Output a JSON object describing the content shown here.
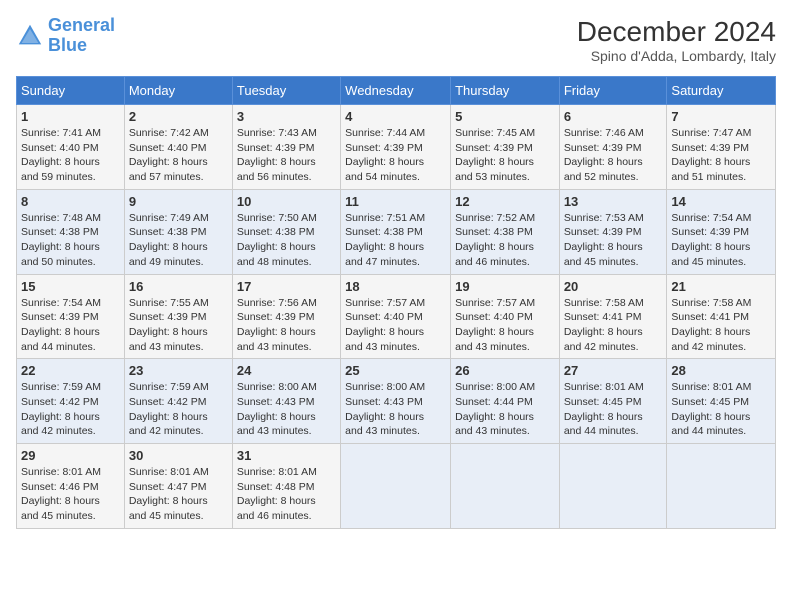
{
  "header": {
    "logo_line1": "General",
    "logo_line2": "Blue",
    "month_year": "December 2024",
    "location": "Spino d'Adda, Lombardy, Italy"
  },
  "weekdays": [
    "Sunday",
    "Monday",
    "Tuesday",
    "Wednesday",
    "Thursday",
    "Friday",
    "Saturday"
  ],
  "weeks": [
    [
      {
        "day": "1",
        "sunrise": "7:41 AM",
        "sunset": "4:40 PM",
        "daylight": "8 hours and 59 minutes."
      },
      {
        "day": "2",
        "sunrise": "7:42 AM",
        "sunset": "4:40 PM",
        "daylight": "8 hours and 57 minutes."
      },
      {
        "day": "3",
        "sunrise": "7:43 AM",
        "sunset": "4:39 PM",
        "daylight": "8 hours and 56 minutes."
      },
      {
        "day": "4",
        "sunrise": "7:44 AM",
        "sunset": "4:39 PM",
        "daylight": "8 hours and 54 minutes."
      },
      {
        "day": "5",
        "sunrise": "7:45 AM",
        "sunset": "4:39 PM",
        "daylight": "8 hours and 53 minutes."
      },
      {
        "day": "6",
        "sunrise": "7:46 AM",
        "sunset": "4:39 PM",
        "daylight": "8 hours and 52 minutes."
      },
      {
        "day": "7",
        "sunrise": "7:47 AM",
        "sunset": "4:39 PM",
        "daylight": "8 hours and 51 minutes."
      }
    ],
    [
      {
        "day": "8",
        "sunrise": "7:48 AM",
        "sunset": "4:38 PM",
        "daylight": "8 hours and 50 minutes."
      },
      {
        "day": "9",
        "sunrise": "7:49 AM",
        "sunset": "4:38 PM",
        "daylight": "8 hours and 49 minutes."
      },
      {
        "day": "10",
        "sunrise": "7:50 AM",
        "sunset": "4:38 PM",
        "daylight": "8 hours and 48 minutes."
      },
      {
        "day": "11",
        "sunrise": "7:51 AM",
        "sunset": "4:38 PM",
        "daylight": "8 hours and 47 minutes."
      },
      {
        "day": "12",
        "sunrise": "7:52 AM",
        "sunset": "4:38 PM",
        "daylight": "8 hours and 46 minutes."
      },
      {
        "day": "13",
        "sunrise": "7:53 AM",
        "sunset": "4:39 PM",
        "daylight": "8 hours and 45 minutes."
      },
      {
        "day": "14",
        "sunrise": "7:54 AM",
        "sunset": "4:39 PM",
        "daylight": "8 hours and 45 minutes."
      }
    ],
    [
      {
        "day": "15",
        "sunrise": "7:54 AM",
        "sunset": "4:39 PM",
        "daylight": "8 hours and 44 minutes."
      },
      {
        "day": "16",
        "sunrise": "7:55 AM",
        "sunset": "4:39 PM",
        "daylight": "8 hours and 43 minutes."
      },
      {
        "day": "17",
        "sunrise": "7:56 AM",
        "sunset": "4:39 PM",
        "daylight": "8 hours and 43 minutes."
      },
      {
        "day": "18",
        "sunrise": "7:57 AM",
        "sunset": "4:40 PM",
        "daylight": "8 hours and 43 minutes."
      },
      {
        "day": "19",
        "sunrise": "7:57 AM",
        "sunset": "4:40 PM",
        "daylight": "8 hours and 43 minutes."
      },
      {
        "day": "20",
        "sunrise": "7:58 AM",
        "sunset": "4:41 PM",
        "daylight": "8 hours and 42 minutes."
      },
      {
        "day": "21",
        "sunrise": "7:58 AM",
        "sunset": "4:41 PM",
        "daylight": "8 hours and 42 minutes."
      }
    ],
    [
      {
        "day": "22",
        "sunrise": "7:59 AM",
        "sunset": "4:42 PM",
        "daylight": "8 hours and 42 minutes."
      },
      {
        "day": "23",
        "sunrise": "7:59 AM",
        "sunset": "4:42 PM",
        "daylight": "8 hours and 42 minutes."
      },
      {
        "day": "24",
        "sunrise": "8:00 AM",
        "sunset": "4:43 PM",
        "daylight": "8 hours and 43 minutes."
      },
      {
        "day": "25",
        "sunrise": "8:00 AM",
        "sunset": "4:43 PM",
        "daylight": "8 hours and 43 minutes."
      },
      {
        "day": "26",
        "sunrise": "8:00 AM",
        "sunset": "4:44 PM",
        "daylight": "8 hours and 43 minutes."
      },
      {
        "day": "27",
        "sunrise": "8:01 AM",
        "sunset": "4:45 PM",
        "daylight": "8 hours and 44 minutes."
      },
      {
        "day": "28",
        "sunrise": "8:01 AM",
        "sunset": "4:45 PM",
        "daylight": "8 hours and 44 minutes."
      }
    ],
    [
      {
        "day": "29",
        "sunrise": "8:01 AM",
        "sunset": "4:46 PM",
        "daylight": "8 hours and 45 minutes."
      },
      {
        "day": "30",
        "sunrise": "8:01 AM",
        "sunset": "4:47 PM",
        "daylight": "8 hours and 45 minutes."
      },
      {
        "day": "31",
        "sunrise": "8:01 AM",
        "sunset": "4:48 PM",
        "daylight": "8 hours and 46 minutes."
      },
      null,
      null,
      null,
      null
    ]
  ],
  "labels": {
    "sunrise": "Sunrise:",
    "sunset": "Sunset:",
    "daylight": "Daylight:"
  }
}
